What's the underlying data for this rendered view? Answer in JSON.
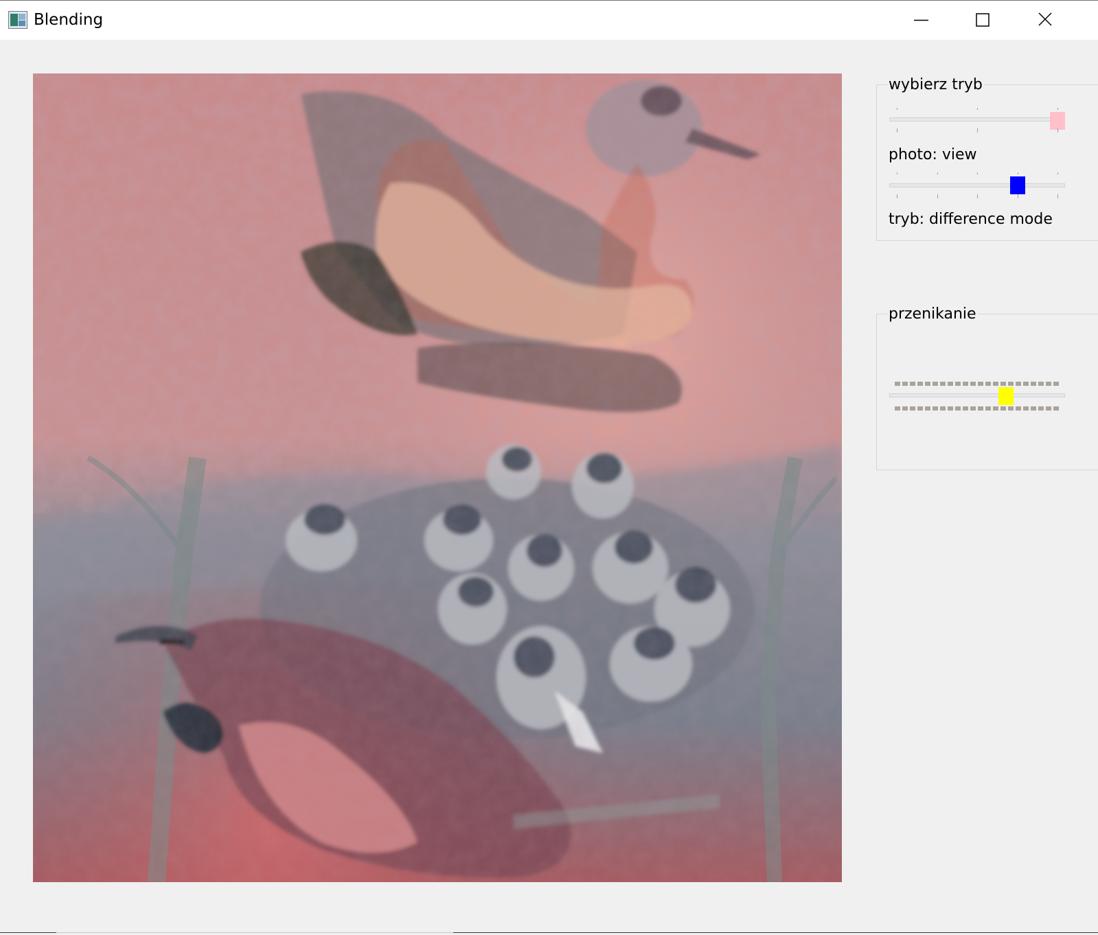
{
  "window": {
    "title": "Blending",
    "icon": "blending-app-icon",
    "controls": {
      "minimize_icon": "minimize-icon",
      "maximize_icon": "maximize-icon",
      "close_icon": "close-icon"
    }
  },
  "image": {
    "description_icon": "blended-photo-canvas"
  },
  "mode_group": {
    "title": "wybierz tryb",
    "mode_slider": {
      "value_fraction": 1.0,
      "tick_count": 3,
      "handle_color": "#ffc0cb"
    },
    "photo_label": "photo: view",
    "photo_slider": {
      "value_fraction": 0.75,
      "tick_count": 5,
      "handle_color": "#0000ff"
    },
    "mode_label": "tryb: difference mode"
  },
  "blend_group": {
    "title": "przenikanie",
    "blend_slider": {
      "value_fraction": 0.68,
      "handle_color": "#ffff00",
      "tick_color": "#a8a39b"
    }
  }
}
